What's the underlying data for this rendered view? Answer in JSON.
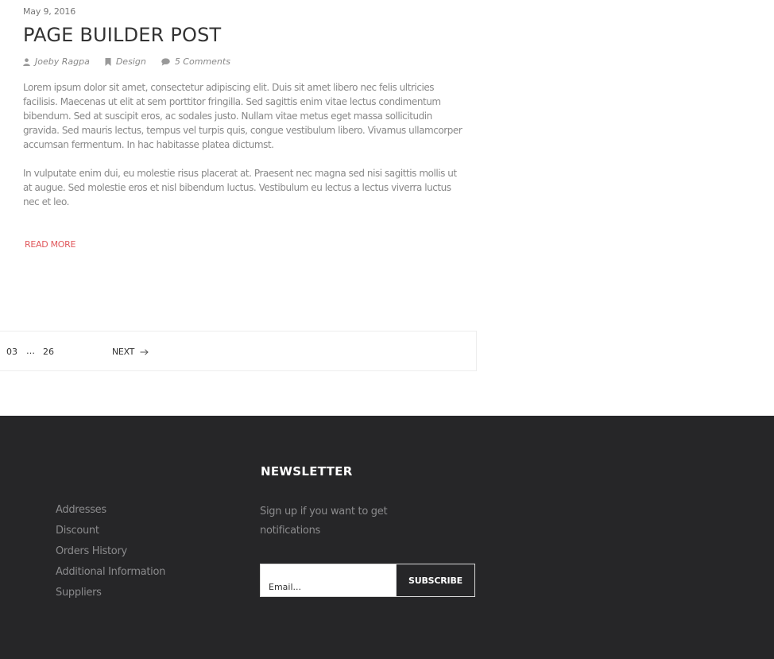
{
  "post": {
    "date": "May 9, 2016",
    "title": "PAGE BUILDER POST",
    "author": "Joeby Ragpa",
    "category": "Design",
    "comments": "5 Comments",
    "paragraph1": "Lorem ipsum dolor sit amet, consectetur adipiscing elit. Duis sit amet libero nec felis ultricies facilisis. Maecenas ut elit at sem porttitor fringilla. Sed sagittis enim vitae lectus condimentum bibendum. Sed at suscipit eros, ac sodales justo. Nullam vitae metus eget massa sollicitudin gravida. Sed mauris lectus, tempus vel turpis quis, congue vestibulum libero. Vivamus ullamcorper accumsan fermentum. In hac habitasse platea dictumst.",
    "paragraph2": "In vulputate enim dui, eu molestie risus placerat at. Praesent nec magna sed nisi sagittis mollis ut at augue. Sed molestie eros et nisl bibendum luctus. Vestibulum eu lectus a lectus viverra luctus nec et leo.",
    "read_more": "READ MORE"
  },
  "pagination": {
    "page_a": "03",
    "ellipsis": "…",
    "page_b": "26",
    "next": "NEXT"
  },
  "footer": {
    "links": [
      "Addresses",
      "Discount",
      "Orders History",
      "Additional Information",
      "Suppliers"
    ],
    "newsletter_title": "NEWSLETTER",
    "newsletter_text": "Sign up if you want to get notifications",
    "email_placeholder": "Email...",
    "subscribe": "SUBSCRIBE"
  },
  "colors": {
    "accent": "#e0585c",
    "footer_bg": "#262628"
  }
}
